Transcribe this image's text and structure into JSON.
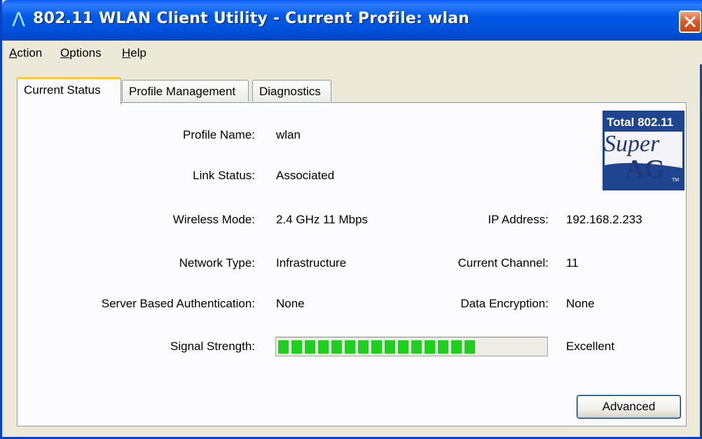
{
  "window": {
    "title": "802.11 WLAN Client Utility - Current Profile: wlan",
    "title_icon": "Λ"
  },
  "menu": [
    {
      "label": "Action",
      "accel": "A",
      "rest": "ction"
    },
    {
      "label": "Options",
      "accel": "O",
      "rest": "ptions"
    },
    {
      "label": "Help",
      "accel": "H",
      "rest": "elp"
    }
  ],
  "tabs": [
    {
      "label": "Current Status",
      "active": true
    },
    {
      "label": "Profile Management",
      "active": false
    },
    {
      "label": "Diagnostics",
      "active": false
    }
  ],
  "status": {
    "profile_name_label": "Profile Name:",
    "profile_name": "wlan",
    "link_status_label": "Link Status:",
    "link_status": "Associated",
    "wireless_mode_label": "Wireless Mode:",
    "wireless_mode": "2.4 GHz 11 Mbps",
    "network_type_label": "Network Type:",
    "network_type": "Infrastructure",
    "server_auth_label": "Server Based Authentication:",
    "server_auth": "None",
    "signal_strength_label": "Signal Strength:",
    "signal_strength": "Excellent",
    "signal_level": 0.77,
    "ip_address_label": "IP Address:",
    "ip_address": "192.168.2.233",
    "current_channel_label": "Current Channel:",
    "current_channel": "11",
    "data_encryption_label": "Data Encryption:",
    "data_encryption": "None"
  },
  "logo": {
    "line1": "Total 802.11",
    "line2": "Super",
    "line3": "AG",
    "tm": "TM"
  },
  "buttons": {
    "advanced": "Advanced"
  },
  "colors": {
    "titlebar": "#0054E3",
    "signal": "#1ED01E",
    "tab_highlight": "#FFC83C",
    "close": "#D9531E"
  }
}
